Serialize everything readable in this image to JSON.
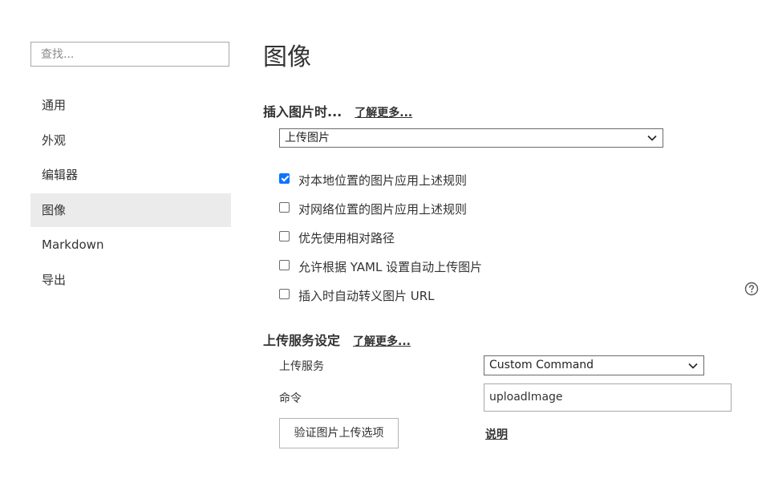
{
  "sidebar": {
    "search_placeholder": "查找...",
    "items": [
      {
        "label": "通用",
        "active": false
      },
      {
        "label": "外观",
        "active": false
      },
      {
        "label": "编辑器",
        "active": false
      },
      {
        "label": "图像",
        "active": true
      },
      {
        "label": "Markdown",
        "active": false
      },
      {
        "label": "导出",
        "active": false
      }
    ]
  },
  "main": {
    "title": "图像",
    "insert_section": {
      "heading": "插入图片时...",
      "learn_more": "了解更多...",
      "action_select": "上传图片",
      "options": [
        {
          "label": "对本地位置的图片应用上述规则",
          "checked": true
        },
        {
          "label": "对网络位置的图片应用上述规则",
          "checked": false
        },
        {
          "label": "优先使用相对路径",
          "checked": false
        },
        {
          "label": "允许根据 YAML 设置自动上传图片",
          "checked": false
        },
        {
          "label": "插入时自动转义图片 URL",
          "checked": false
        }
      ],
      "help_icon": "help-circle-icon"
    },
    "upload_section": {
      "heading": "上传服务设定",
      "learn_more": "了解更多...",
      "service_label": "上传服务",
      "service_value": "Custom Command",
      "command_label": "命令",
      "command_value": "uploadImage",
      "verify_button": "验证图片上传选项",
      "explain_link": "说明"
    }
  },
  "colors": {
    "accent": "#0a75ff",
    "active_nav_bg": "#ebebeb",
    "text": "#333333"
  }
}
